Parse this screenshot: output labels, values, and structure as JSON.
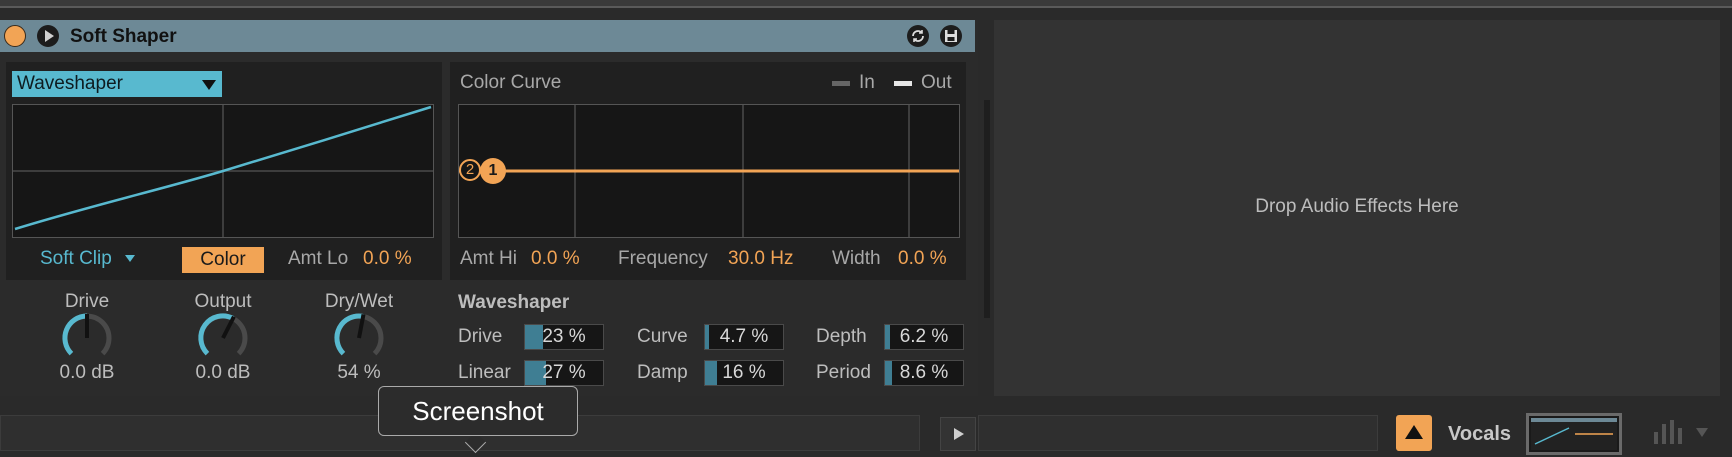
{
  "device": {
    "title": "Soft Shaper",
    "icons": {
      "power": "power-icon",
      "play": "play-icon",
      "refresh": "refresh-icon",
      "save": "save-icon"
    }
  },
  "shaper": {
    "mode_dropdown": "Waveshaper",
    "curve_type": "Soft Clip",
    "color_button": "Color",
    "amt_lo_label": "Amt Lo",
    "amt_lo_value": "0.0 %"
  },
  "color_curve": {
    "title": "Color Curve",
    "legend_in": "In",
    "legend_out": "Out",
    "point_1": "1",
    "point_2": "2",
    "amt_hi_label": "Amt Hi",
    "amt_hi_value": "0.0 %",
    "frequency_label": "Frequency",
    "frequency_value": "30.0 Hz",
    "width_label": "Width",
    "width_value": "0.0 %"
  },
  "knobs": [
    {
      "label": "Drive",
      "value": "0.0 dB",
      "level": 0.5
    },
    {
      "label": "Output",
      "value": "0.0 dB",
      "level": 0.6
    },
    {
      "label": "Dry/Wet",
      "value": "54 %",
      "level": 0.54
    }
  ],
  "waveshaper": {
    "title": "Waveshaper",
    "params": [
      {
        "label": "Drive",
        "value": "23 %",
        "fill": 0.23
      },
      {
        "label": "Curve",
        "value": "4.7 %",
        "fill": 0.047
      },
      {
        "label": "Depth",
        "value": "6.2 %",
        "fill": 0.062
      },
      {
        "label": "Linear",
        "value": "27 %",
        "fill": 0.27
      },
      {
        "label": "Damp",
        "value": "16 %",
        "fill": 0.16
      },
      {
        "label": "Period",
        "value": "8.6 %",
        "fill": 0.086
      }
    ]
  },
  "drop_zone": {
    "text": "Drop Audio Effects Here"
  },
  "bottom": {
    "track_name": "Vocals"
  },
  "tooltip": {
    "text": "Screenshot"
  },
  "colors": {
    "accent_orange": "#f2a455",
    "accent_cyan": "#58b9cf",
    "title_bar": "#6d8996"
  }
}
